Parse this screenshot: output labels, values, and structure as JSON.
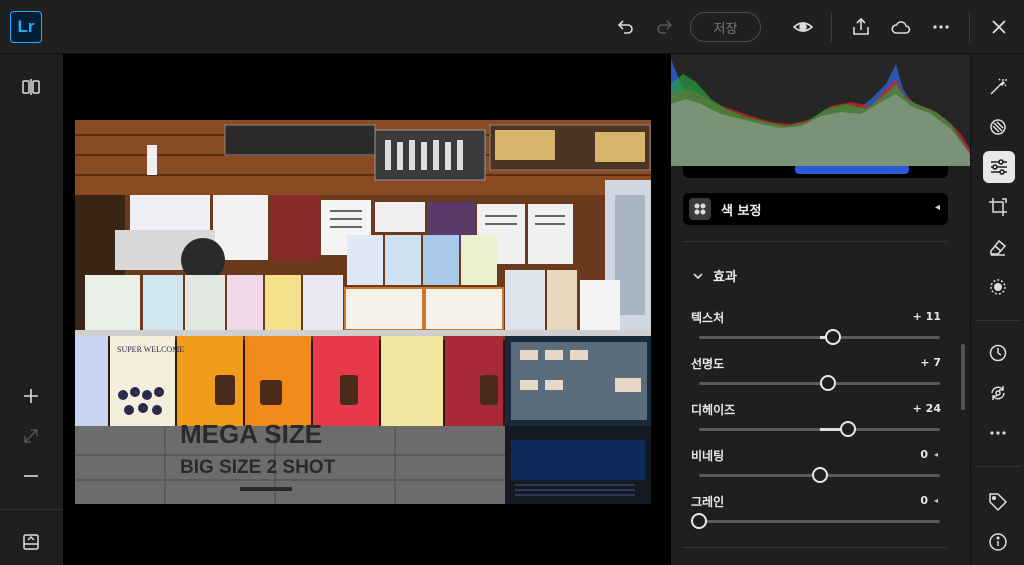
{
  "app": {
    "logo_text": "Lr",
    "logo_color": "#31a8ff"
  },
  "toolbar": {
    "save_label": "저장",
    "icons": [
      "undo-icon",
      "redo-icon",
      "eye-icon",
      "share-icon",
      "cloud-icon",
      "more-icon",
      "close-icon"
    ]
  },
  "left_rail": {
    "icons": [
      "compare-icon",
      "zoom-in-icon",
      "fit-icon",
      "zoom-out-icon",
      "filmstrip-icon"
    ]
  },
  "panel": {
    "color_grading_label": "색 보정",
    "effects_label": "효과",
    "sliders": [
      {
        "label": "텍스처",
        "value_text": "+ 11",
        "value": 11,
        "locked": false
      },
      {
        "label": "선명도",
        "value_text": "+ 7",
        "value": 7,
        "locked": false
      },
      {
        "label": "디헤이즈",
        "value_text": "+ 24",
        "value": 24,
        "locked": false
      },
      {
        "label": "비네팅",
        "value_text": "0",
        "value": 0,
        "locked": true
      },
      {
        "label": "그레인",
        "value_text": "0",
        "value": 0,
        "locked": true,
        "min_based": true
      }
    ]
  },
  "photo": {
    "sign_line1": "MEGA SIZE",
    "sign_line2": "BIG SIZE 2 SHOT",
    "poster_text": "SUPER WELCOME"
  },
  "right_rail": {
    "icons": [
      "auto-edit-icon",
      "presets-icon",
      "adjust-icon",
      "crop-icon",
      "heal-icon",
      "masking-icon",
      "history-icon",
      "versions-icon",
      "more-icon",
      "tag-icon",
      "info-icon"
    ],
    "active": "adjust-icon"
  },
  "colors": {
    "accent": "#2a5bd7",
    "panel_bg": "#1f1f1f",
    "topbar_bg": "#202020"
  }
}
